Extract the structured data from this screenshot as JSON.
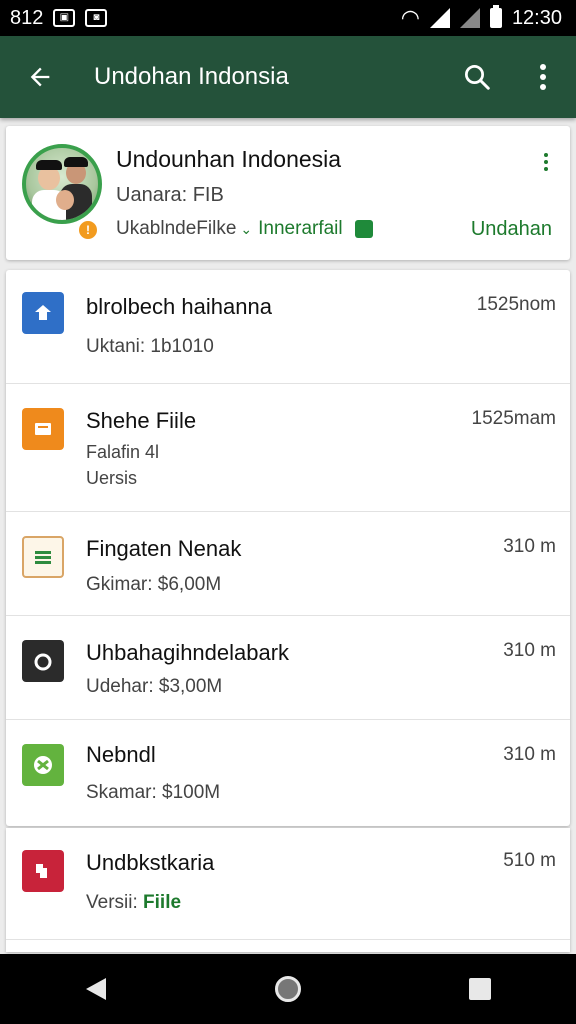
{
  "status_bar": {
    "time_left": "812",
    "time": "12:30",
    "icons": [
      "image-notification-icon",
      "photo-notification-icon",
      "wifi-icon",
      "signal-icon",
      "signal-icon",
      "battery-icon"
    ]
  },
  "app_bar": {
    "title": "Undohan Indonsia",
    "icons": [
      "back-arrow-icon",
      "search-icon",
      "more-vert-icon"
    ]
  },
  "header": {
    "title": "Undounhan Indonesia",
    "subtitle": "Uanara: FIB",
    "link_text": "UkablndeFilke",
    "link_green": "Innerarfail",
    "action_label": "Undahan",
    "colors": {
      "accent": "#1d7a2d",
      "badge": "#f29b1f"
    }
  },
  "files": [
    {
      "title": "blrolbech haihanna",
      "sub": "Uktani: 1b1010",
      "size": "1525nom",
      "icon": "upload-doc-icon",
      "color": "#2f6fc7"
    },
    {
      "title": "Shehe Fiile",
      "sub": "Falafin 4l",
      "sub2": "Uersis",
      "size": "1525mam",
      "icon": "slides-file-icon",
      "color": "#ef8a1c"
    },
    {
      "title": "Fingaten Nenak",
      "sub": "Gkimar: $6,00M",
      "size": "310 m",
      "icon": "sheet-file-icon",
      "color": "#2e8b3e"
    },
    {
      "title": "Uhbahagihndelabark",
      "sub": "Udehar: $3,00M",
      "size": "310 m",
      "icon": "camera-icon",
      "color": "#2b2b2b"
    },
    {
      "title": "Nebndl",
      "sub": "Skamar: $100M",
      "size": "310 m",
      "icon": "tools-icon",
      "color": "#63b33e"
    },
    {
      "title": "Undbkstkaria",
      "sub_prefix": "Versii:",
      "sub_green": "Fiile",
      "size": "510 m",
      "icon": "puzzle-icon",
      "color": "#c8233a"
    }
  ],
  "nav_bar": {
    "icons": [
      "nav-back-icon",
      "nav-home-icon",
      "nav-recents-icon"
    ]
  }
}
